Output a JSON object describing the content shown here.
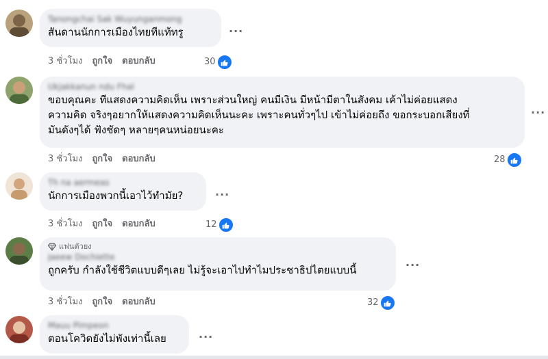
{
  "comments": [
    {
      "author": "Tanongchai Sak Wuyunganmong",
      "text_lines": [
        "สันดานนักการเมืองไทยทีแท้ทรู"
      ],
      "time": "3 ชั่วโมง",
      "like_label": "ถูกใจ",
      "reply_label": "ตอบกลับ",
      "reaction_count": "30",
      "avatar_color": "#8a7a5a"
    },
    {
      "author": "Ukjakkanun ndu Fhal",
      "text_lines": [
        "ขอบคุณคะ ทีแสดงความคิดเห็น เพราะส่วนใหญ่ คนมีเงิน มีหน้ามีตาในสังคม เค้าไม่ค่อยแสดง",
        "ความคิด จริงๆอยากให้แสดงความคิดเห็นนะคะ เพราะคนทั่วๆไป เข้าไม่ค่อยถึง ขอกระบอกเสียงที่",
        "มันดังๆได้ ฟังชัดๆ หลายๆคนหน่อยนะคะ"
      ],
      "time": "3 ชั่วโมง",
      "like_label": "ถูกใจ",
      "reply_label": "ตอบกลับ",
      "reaction_count": "28",
      "avatar_color": "#6f8a55"
    },
    {
      "author": "Th na aermeas",
      "text_lines": [
        "นักการเมืองพวกนี้เอาไว้ทำมัย?"
      ],
      "time": "3 ชั่วโมง",
      "like_label": "ถูกใจ",
      "reply_label": "ตอบกลับ",
      "reaction_count": "12",
      "avatar_color": "#d9c7b0"
    },
    {
      "badge": "แฟนตัวยง",
      "author": "Jaeew Dochiette",
      "text_lines": [
        "ถูกครับ กำลังใช้ชีวิตแบบดีๆเลย ไม่รู้จะเอาไปทำไมประชาธิปไตยแบบนี้"
      ],
      "time": "3 ชั่วโมง",
      "like_label": "ถูกใจ",
      "reply_label": "ตอบกลับ",
      "reaction_count": "32",
      "avatar_color": "#4f6b3a"
    },
    {
      "author": "Mauu Pimpeon",
      "text_lines": [
        "ตอนโควิดยังไม่พังเท่านี้เลย"
      ],
      "avatar_color": "#a0523d"
    }
  ],
  "more_label": "···",
  "colors": {
    "like_blue": "#1877f2",
    "bubble_bg": "#f0f2f5",
    "muted": "#65676b"
  }
}
